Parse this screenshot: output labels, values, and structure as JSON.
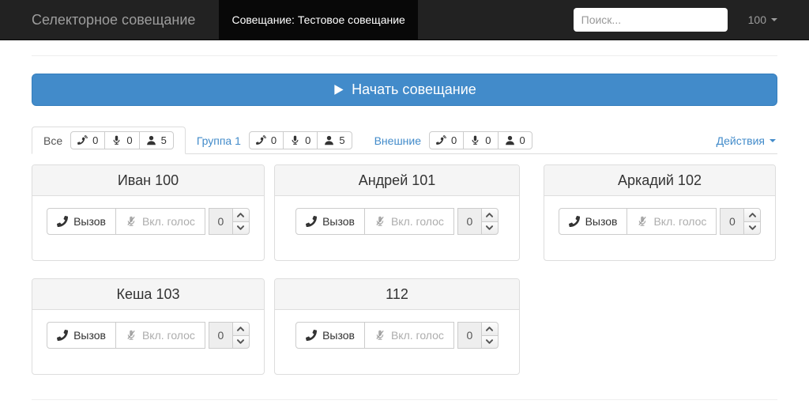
{
  "navbar": {
    "brand": "Селекторное совещание",
    "active_item": "Совещание: Тестовое совещание",
    "search": {
      "placeholder": "Поиск..."
    },
    "account": "100"
  },
  "start_meeting_button": "Начать совещание",
  "tab_bar": {
    "tabs": [
      {
        "label": "Все",
        "calls": "0",
        "mics": "0",
        "members": "5"
      },
      {
        "label": "Группа 1",
        "calls": "0",
        "mics": "0",
        "members": "5"
      },
      {
        "label": "Внешние",
        "calls": "0",
        "mics": "0",
        "members": "0"
      }
    ],
    "actions": "Действия"
  },
  "cards": {
    "call_label": "Вызов",
    "voice_label": "Вкл. голос",
    "participants": [
      {
        "name": "Иван 100",
        "value": "0"
      },
      {
        "name": "Андрей 101",
        "value": "0"
      },
      {
        "name": "Аркадий 102",
        "value": "0"
      },
      {
        "name": "Кеша 103",
        "value": "0"
      },
      {
        "name": "112",
        "value": "0"
      }
    ]
  },
  "icons": {
    "start": "play-icon",
    "tab_calls": "phone-volume-icon",
    "tab_mics": "microphone-icon",
    "tab_members": "user-icon",
    "card_call": "phone-icon",
    "card_voice": "microphone-slash-icon",
    "dropdown": "caret-down-icon",
    "spinner": "chevron-up-icon / chevron-down-icon"
  },
  "colors": {
    "navbar_bg": "#222222",
    "navbar_active_bg": "#080808",
    "navbar_text": "#9d9d9d",
    "primary": "#428bca",
    "primary_border": "#357ebd",
    "card_header_bg": "#f5f5f5",
    "border": "#dddddd",
    "control_border": "#cccccc",
    "muted_text": "#adadad"
  }
}
